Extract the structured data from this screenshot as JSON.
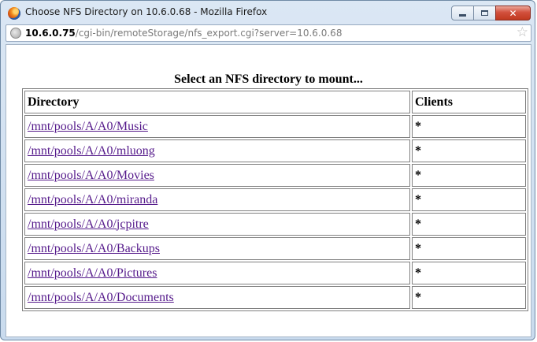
{
  "window": {
    "title": "Choose NFS Directory on 10.6.0.68 - Mozilla Firefox",
    "buttons": {
      "minimize": "minimize",
      "maximize": "maximize",
      "close": "✕"
    }
  },
  "urlbar": {
    "host": "10.6.0.75",
    "path": "/cgi-bin/remoteStorage/nfs_export.cgi?server=10.6.0.68"
  },
  "page": {
    "heading": "Select an NFS directory to mount...",
    "columns": {
      "directory": "Directory",
      "clients": "Clients"
    },
    "rows": [
      {
        "directory": "/mnt/pools/A/A0/Music",
        "clients": "*"
      },
      {
        "directory": "/mnt/pools/A/A0/mluong",
        "clients": "*"
      },
      {
        "directory": "/mnt/pools/A/A0/Movies",
        "clients": "*"
      },
      {
        "directory": "/mnt/pools/A/A0/miranda",
        "clients": "*"
      },
      {
        "directory": "/mnt/pools/A/A0/jcpitre",
        "clients": "*"
      },
      {
        "directory": "/mnt/pools/A/A0/Backups",
        "clients": "*"
      },
      {
        "directory": "/mnt/pools/A/A0/Pictures",
        "clients": "*"
      },
      {
        "directory": "/mnt/pools/A/A0/Documents",
        "clients": "*"
      }
    ]
  },
  "icons": {
    "app": "firefox-icon",
    "site": "globe-icon",
    "bookmark": "star-icon"
  },
  "colors": {
    "link_visited": "#551a8b",
    "titlebar": "#c9dbee",
    "close_button": "#c0391f"
  }
}
